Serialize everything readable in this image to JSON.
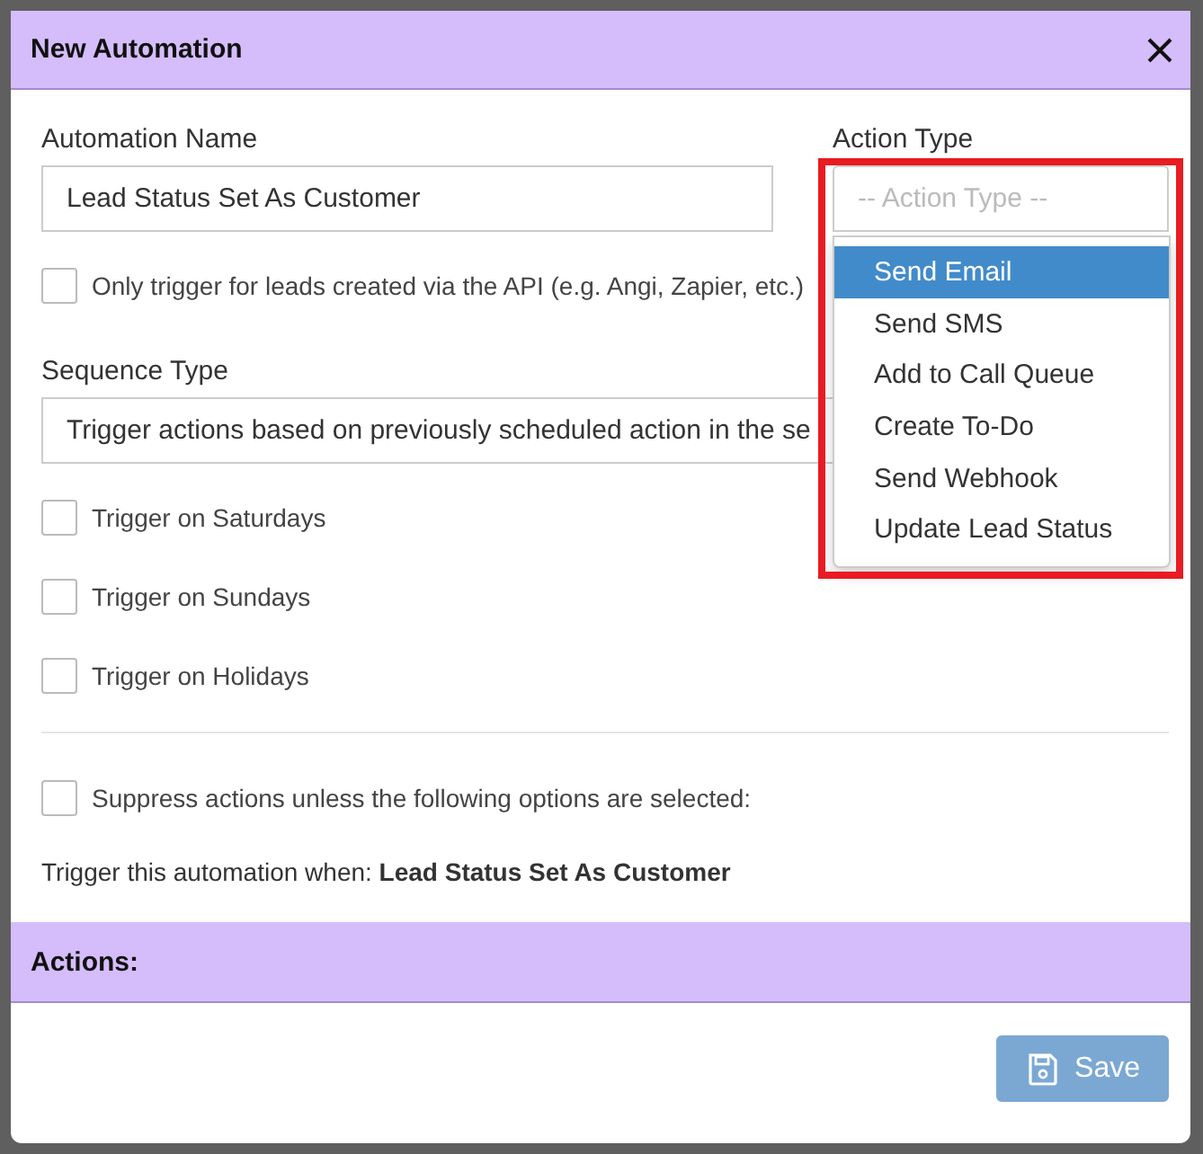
{
  "dialog": {
    "title": "New Automation"
  },
  "automation_name": {
    "label": "Automation Name",
    "value": "Lead Status Set As Customer"
  },
  "action_type": {
    "label": "Action Type",
    "placeholder": "-- Action Type --",
    "expanded": true,
    "highlighted": true,
    "options": [
      {
        "label": "Send Email",
        "selected": true
      },
      {
        "label": "Send SMS",
        "selected": false
      },
      {
        "label": "Add to Call Queue",
        "selected": false
      },
      {
        "label": "Create To-Do",
        "selected": false
      },
      {
        "label": "Send Webhook",
        "selected": false
      },
      {
        "label": "Update Lead Status",
        "selected": false
      }
    ]
  },
  "api_only": {
    "label": "Only trigger for leads created via the API (e.g. Angi, Zapier, etc.)",
    "checked": false
  },
  "sequence_type": {
    "label": "Sequence Type",
    "value": "Trigger actions based on previously scheduled action in the se"
  },
  "day_options": [
    {
      "label": "Trigger on Saturdays",
      "checked": false
    },
    {
      "label": "Trigger on Sundays",
      "checked": false
    },
    {
      "label": "Trigger on Holidays",
      "checked": false
    }
  ],
  "suppress": {
    "label": "Suppress actions unless the following options are selected:",
    "checked": false
  },
  "summary": "Trigger this automation when: **Lead Status Set As Customer**",
  "actions_header": "Actions:",
  "save_button": {
    "label": "Save",
    "disabled": true
  }
}
